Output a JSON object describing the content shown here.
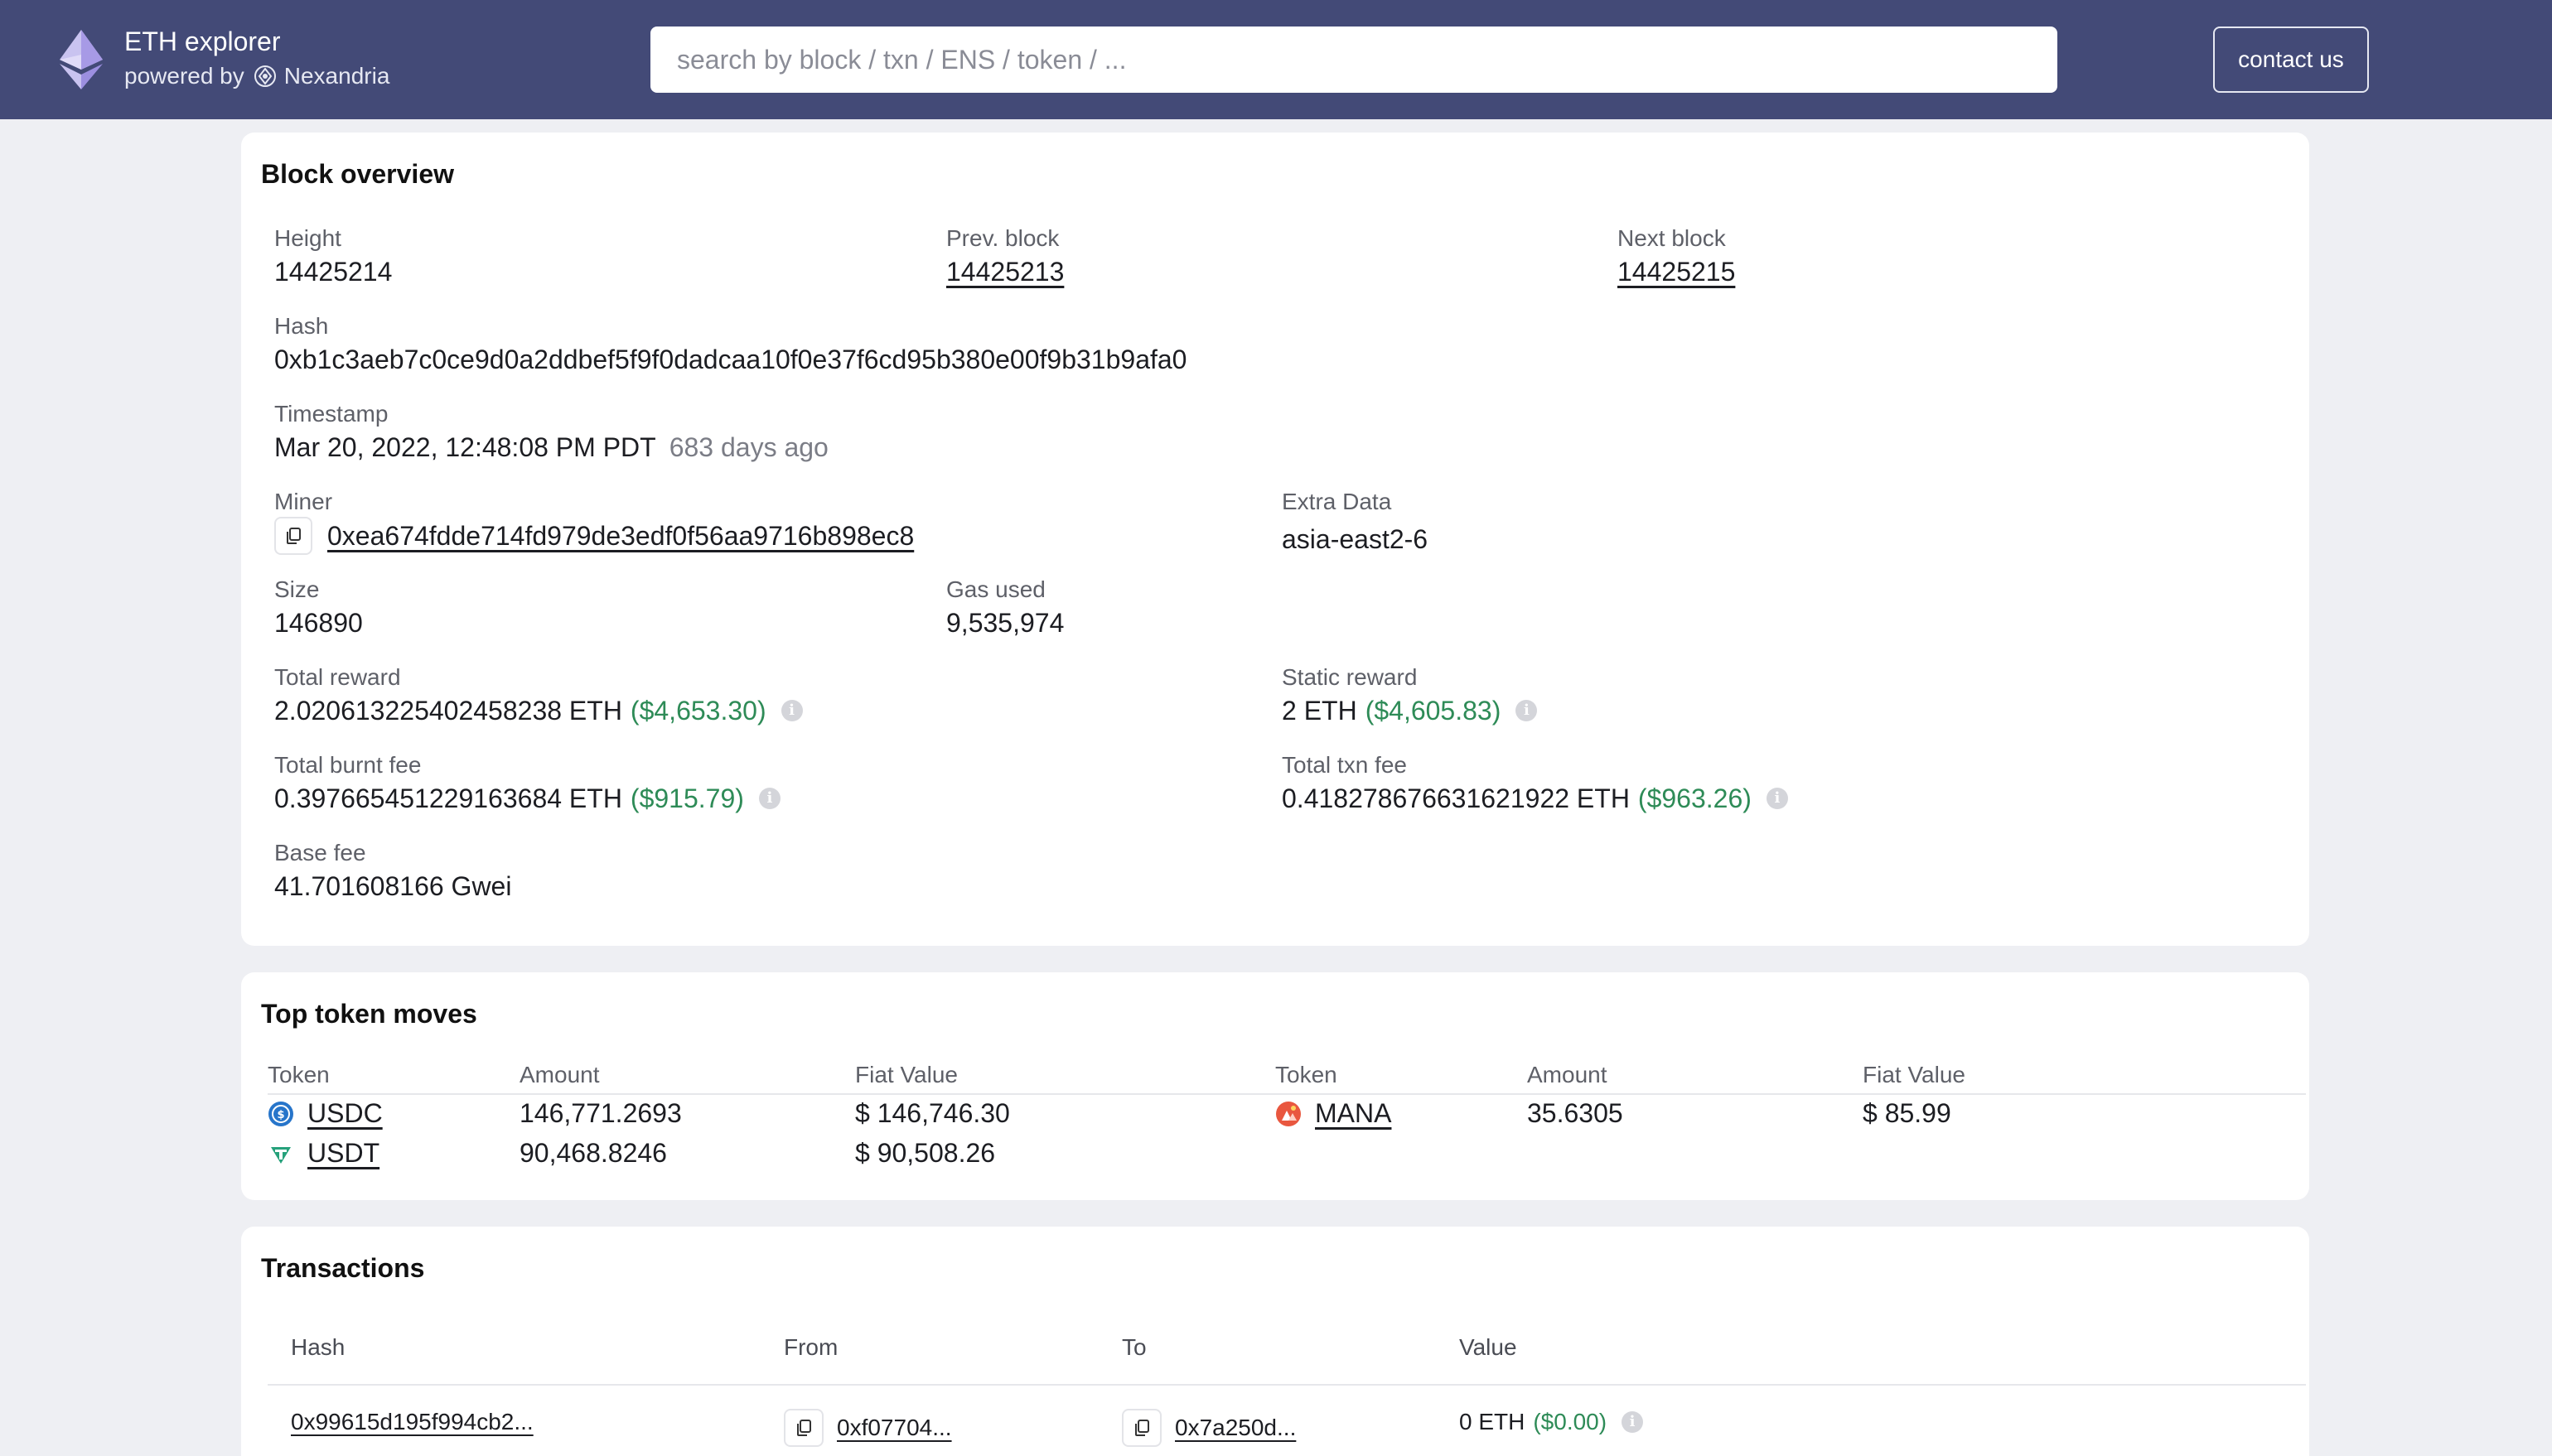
{
  "header": {
    "title": "ETH explorer",
    "powered_by": "powered by",
    "powered_brand": "Nexandria",
    "search_placeholder": "search by block / txn / ENS / token / ...",
    "contact_label": "contact us",
    "bg_color": "#434a77"
  },
  "block_overview": {
    "title": "Block overview",
    "height_label": "Height",
    "height": "14425214",
    "prev_label": "Prev. block",
    "prev": "14425213",
    "next_label": "Next block",
    "next": "14425215",
    "hash_label": "Hash",
    "hash": "0xb1c3aeb7c0ce9d0a2ddbef5f9f0dadcaa10f0e37f6cd95b380e00f9b31b9afa0",
    "timestamp_label": "Timestamp",
    "timestamp": "Mar 20, 2022, 12:48:08 PM PDT",
    "timestamp_ago": "683 days ago",
    "miner_label": "Miner",
    "miner": "0xea674fdde714fd979de3edf0f56aa9716b898ec8",
    "extra_label": "Extra Data",
    "extra": "asia-east2-6",
    "size_label": "Size",
    "size": "146890",
    "gas_label": "Gas used",
    "gas": "9,535,974",
    "total_reward_label": "Total reward",
    "total_reward": "2.020613225402458238 ETH",
    "total_reward_usd": "($4,653.30)",
    "static_reward_label": "Static reward",
    "static_reward": "2 ETH",
    "static_reward_usd": "($4,605.83)",
    "burnt_label": "Total burnt fee",
    "burnt": "0.397665451229163684 ETH",
    "burnt_usd": "($915.79)",
    "txn_fee_label": "Total txn fee",
    "txn_fee": "0.418278676631621922 ETH",
    "txn_fee_usd": "($963.26)",
    "base_fee_label": "Base fee",
    "base_fee": "41.701608166 Gwei",
    "info_glyph": "i"
  },
  "token_moves": {
    "title": "Top token moves",
    "headers": [
      "Token",
      "Amount",
      "Fiat Value"
    ],
    "left": [
      {
        "token": "USDC",
        "amount": "146,771.2693",
        "fiat": "$ 146,746.30",
        "icon": "usdc-icon"
      },
      {
        "token": "USDT",
        "amount": "90,468.8246",
        "fiat": "$ 90,508.26",
        "icon": "usdt-icon"
      }
    ],
    "right": [
      {
        "token": "MANA",
        "amount": "35.6305",
        "fiat": "$ 85.99",
        "icon": "mana-icon"
      }
    ]
  },
  "transactions": {
    "title": "Transactions",
    "headers": {
      "hash": "Hash",
      "from": "From",
      "to": "To",
      "value": "Value"
    },
    "rows": [
      {
        "hash": "0x99615d195f994cb2...",
        "from": "0xf07704...",
        "to": "0x7a250d...",
        "value": "0 ETH",
        "value_usd": "($0.00)"
      }
    ]
  },
  "colors": {
    "accent_green": "#2e8b57",
    "usdc": "#2775ca",
    "usdt": "#26a17b",
    "mana": "#e9573f"
  }
}
